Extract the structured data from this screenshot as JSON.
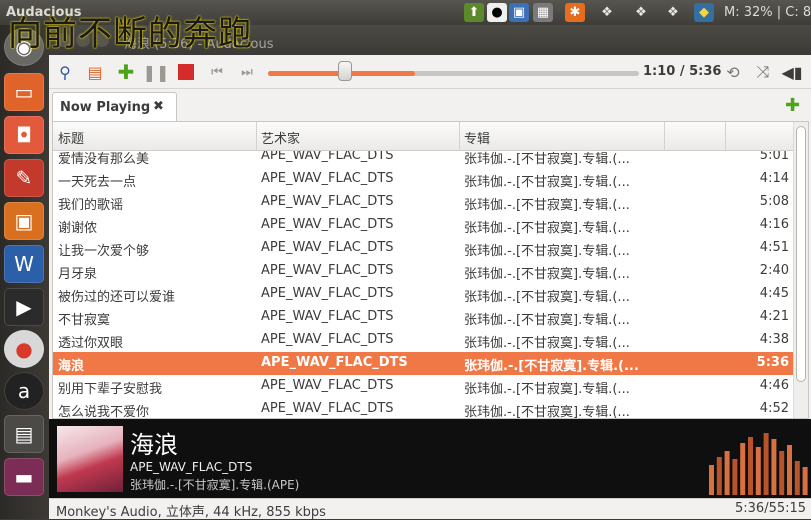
{
  "top_panel": {
    "app_name": "Audacious",
    "overlay_lyric": "向前不断的奔跑",
    "status_text": "M: 32% | C: 8"
  },
  "window": {
    "title": "海浪 (5:36) - Audacious"
  },
  "toolbar": {
    "time": "1:10 / 5:36",
    "progress_fraction": 0.208
  },
  "tabs": [
    {
      "label": "Now Playing",
      "close": "✖"
    }
  ],
  "add_tab": "✚",
  "playlist": {
    "columns": [
      "标题",
      "艺术家",
      "专辑"
    ],
    "rows": [
      {
        "title": "爱情没有那么美",
        "artist": "APE_WAV_FLAC_DTS",
        "album": "张玮伽.-.[不甘寂寞].专辑.(...",
        "length": "5:01"
      },
      {
        "title": "一天死去一点",
        "artist": "APE_WAV_FLAC_DTS",
        "album": "张玮伽.-.[不甘寂寞].专辑.(...",
        "length": "4:14"
      },
      {
        "title": "我们的歌谣",
        "artist": "APE_WAV_FLAC_DTS",
        "album": "张玮伽.-.[不甘寂寞].专辑.(...",
        "length": "5:08"
      },
      {
        "title": "谢谢侬",
        "artist": "APE_WAV_FLAC_DTS",
        "album": "张玮伽.-.[不甘寂寞].专辑.(...",
        "length": "4:16"
      },
      {
        "title": "让我一次爱个够",
        "artist": "APE_WAV_FLAC_DTS",
        "album": "张玮伽.-.[不甘寂寞].专辑.(...",
        "length": "4:51"
      },
      {
        "title": "月牙泉",
        "artist": "APE_WAV_FLAC_DTS",
        "album": "张玮伽.-.[不甘寂寞].专辑.(...",
        "length": "2:40"
      },
      {
        "title": "被伤过的还可以爱谁",
        "artist": "APE_WAV_FLAC_DTS",
        "album": "张玮伽.-.[不甘寂寞].专辑.(...",
        "length": "4:45"
      },
      {
        "title": "不甘寂寞",
        "artist": "APE_WAV_FLAC_DTS",
        "album": "张玮伽.-.[不甘寂寞].专辑.(...",
        "length": "4:21"
      },
      {
        "title": "透过你双眼",
        "artist": "APE_WAV_FLAC_DTS",
        "album": "张玮伽.-.[不甘寂寞].专辑.(...",
        "length": "4:38"
      },
      {
        "title": "海浪",
        "artist": "APE_WAV_FLAC_DTS",
        "album": "张玮伽.-.[不甘寂寞].专辑.(...",
        "length": "5:36",
        "selected": true
      },
      {
        "title": "别用下辈子安慰我",
        "artist": "APE_WAV_FLAC_DTS",
        "album": "张玮伽.-.[不甘寂寞].专辑.(...",
        "length": "4:46"
      },
      {
        "title": "怎么说我不爱你",
        "artist": "APE_WAV_FLAC_DTS",
        "album": "张玮伽.-.[不甘寂寞].专辑.(...",
        "length": "4:52"
      }
    ]
  },
  "now_playing": {
    "title": "海浪",
    "artist": "APE_WAV_FLAC_DTS",
    "album": "张玮伽.-.[不甘寂寞].专辑.(APE)"
  },
  "status": {
    "codec": "Monkey's Audio, 立体声, 44 kHz, 855 kbps",
    "total": "5:36/55:15"
  },
  "colors": {
    "accent": "#f07746",
    "panel": "#3c3b37"
  }
}
